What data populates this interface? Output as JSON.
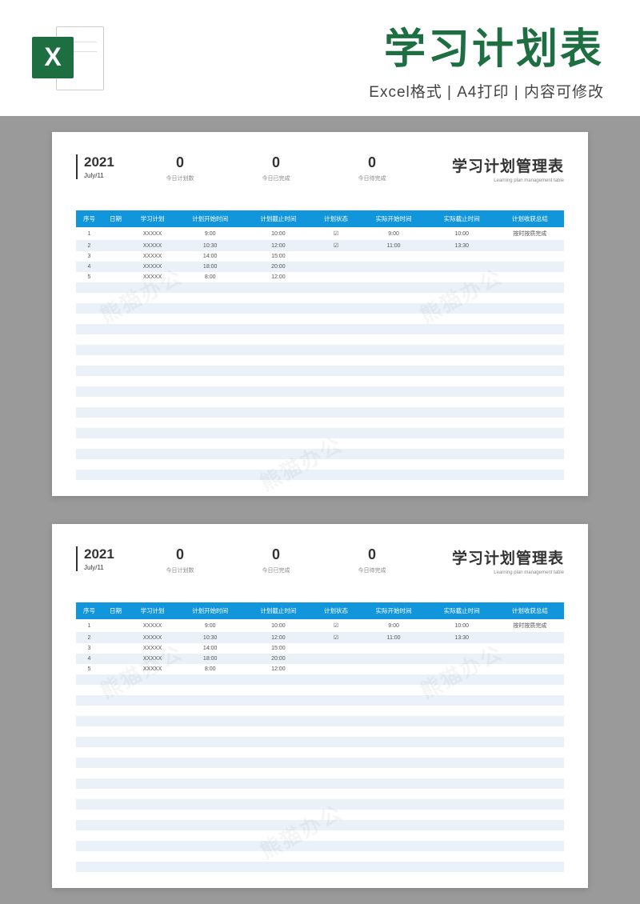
{
  "banner": {
    "title": "学习计划表",
    "subtitle": "Excel格式 | A4打印 | 内容可修改",
    "icon_letter": "X"
  },
  "sheet": {
    "year": "2021",
    "date": "July/11",
    "stats": [
      {
        "value": "0",
        "label": "今日计划数"
      },
      {
        "value": "0",
        "label": "今日已完成"
      },
      {
        "value": "0",
        "label": "今日待完成"
      }
    ],
    "title": "学习计划管理表",
    "title_en": "Learning plan management table",
    "columns": [
      "序号",
      "日期",
      "学习计划",
      "计划开始时间",
      "计划截止时间",
      "计划状态",
      "实际开始时间",
      "实际截止时间",
      "计划收获总结"
    ],
    "rows": [
      {
        "no": "1",
        "date": "",
        "plan": "XXXXX",
        "pstart": "9:00",
        "pend": "10:00",
        "status": "☑",
        "astart": "9:00",
        "aend": "10:00",
        "summary": "按时按质完成"
      },
      {
        "no": "2",
        "date": "",
        "plan": "XXXXX",
        "pstart": "10:30",
        "pend": "12:00",
        "status": "☑",
        "astart": "11:00",
        "aend": "13:30",
        "summary": ""
      },
      {
        "no": "3",
        "date": "",
        "plan": "XXXXX",
        "pstart": "14:00",
        "pend": "15:00",
        "status": "",
        "astart": "",
        "aend": "",
        "summary": ""
      },
      {
        "no": "4",
        "date": "",
        "plan": "XXXXX",
        "pstart": "18:00",
        "pend": "20:00",
        "status": "",
        "astart": "",
        "aend": "",
        "summary": ""
      },
      {
        "no": "5",
        "date": "",
        "plan": "XXXXX",
        "pstart": "8:00",
        "pend": "12:00",
        "status": "",
        "astart": "",
        "aend": "",
        "summary": ""
      }
    ],
    "empty_rows": 20
  },
  "watermark": "熊猫办公"
}
